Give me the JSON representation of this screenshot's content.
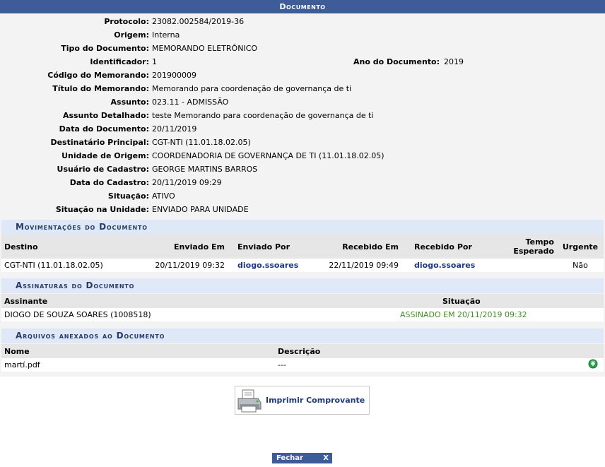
{
  "title": "Documento",
  "fields": [
    {
      "label": "Protocolo:",
      "value": "23082.002584/2019-36"
    },
    {
      "label": "Origem:",
      "value": "Interna"
    },
    {
      "label": "Tipo do Documento:",
      "value": "MEMORANDO ELETRÔNICO"
    },
    {
      "label": "Identificador:",
      "value": "1"
    },
    {
      "label": "Código do Memorando:",
      "value": "201900009"
    },
    {
      "label": "Título do Memorando:",
      "value": "Memorando para coordenação de governança de ti"
    },
    {
      "label": "Assunto:",
      "value": "023.11 - ADMISSÃO"
    },
    {
      "label": "Assunto Detalhado:",
      "value": "teste Memorando para coordenação de governança de ti"
    },
    {
      "label": "Data do Documento:",
      "value": "20/11/2019"
    },
    {
      "label": "Destinatário Principal:",
      "value": "CGT-NTI (11.01.18.02.05)"
    },
    {
      "label": "Unidade de Origem:",
      "value": "COORDENADORIA DE GOVERNANÇA DE TI (11.01.18.02.05)"
    },
    {
      "label": "Usuário de Cadastro:",
      "value": "GEORGE MARTINS BARROS"
    },
    {
      "label": "Data do Cadastro:",
      "value": "20/11/2019 09:29"
    },
    {
      "label": "Situação:",
      "value": "ATIVO"
    },
    {
      "label": "Situação na Unidade:",
      "value": "ENVIADO PARA UNIDADE"
    }
  ],
  "ano": {
    "label": "Ano do Documento:",
    "value": "2019"
  },
  "movimentacoes": {
    "title": "Movimentações do Documento",
    "headers": {
      "destino": "Destino",
      "enviado_em": "Enviado Em",
      "enviado_por": "Enviado Por",
      "recebido_em": "Recebido Em",
      "recebido_por": "Recebido Por",
      "tempo_1": "Tempo",
      "tempo_2": "Esperado",
      "urgente": "Urgente"
    },
    "row": {
      "destino": "CGT-NTI (11.01.18.02.05)",
      "enviado_em": "20/11/2019 09:32",
      "enviado_por": "diogo.ssoares",
      "recebido_em": "22/11/2019 09:49",
      "recebido_por": "diogo.ssoares",
      "tempo": "",
      "urgente": "Não"
    }
  },
  "assinaturas": {
    "title": "Assinaturas do Documento",
    "headers": {
      "assinante": "Assinante",
      "situacao": "Situação"
    },
    "row": {
      "assinante": "DIOGO DE SOUZA SOARES (1008518)",
      "situacao": "ASSINADO EM 20/11/2019 09:32"
    }
  },
  "arquivos": {
    "title": "Arquivos anexados ao Documento",
    "headers": {
      "nome": "Nome",
      "descricao": "Descrição"
    },
    "row": {
      "nome": "martí.pdf",
      "descricao": "---"
    }
  },
  "buttons": {
    "imprimir": "Imprimir Comprovante",
    "fechar": "Fechar",
    "fechar_x": "X"
  },
  "colors": {
    "header_bg": "#3f5c9a",
    "section_bg": "#dfe8f6",
    "link": "#1c3a82",
    "signed": "#3f8c27"
  }
}
